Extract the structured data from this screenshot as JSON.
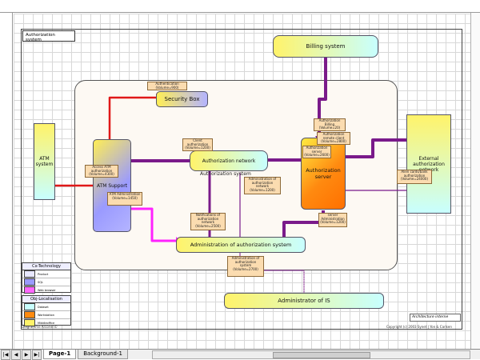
{
  "tabs": [
    "Page-1",
    "Background-1"
  ],
  "diagram": {
    "title": "Authorization system",
    "nodes": {
      "billing": "Billing system",
      "atm_system": "ATM system",
      "security_box": "Security Box",
      "atm_support": "ATM Support",
      "auth_network": "Authorization network",
      "auth_system_sub": "Authorization system",
      "auth_server": "Authorization server",
      "external": "External authorization network",
      "admin_auth": "Administration of authorization system",
      "admin_is": "Administrator of IS"
    },
    "labels": {
      "auth_vol": "Authentication (Volume=900)",
      "access_atm": "Access ATM authorization (Volume=4300)",
      "atm_admin": "ATM Administration (Volume=1450)",
      "client_auth": "Client authorization (Volume=1200)",
      "admin_auth_net": "Administration of authorization network (Volume=1200)",
      "notifications": "Notifications of authorization network (Volume=2500)",
      "auth_billing": "Authorization Billing (Volume=20)",
      "auth_remote": "Authorization remote client (Volume=2800)",
      "auth_server_vol": "Authorization server (Volume=2600)",
      "alien_cards": "Alien cards/bank authorization (Volume=24000)",
      "server_admin": "server Administration (Volume=1200)",
      "admin_sys": "Administration of authorization system (Volume=2700)"
    }
  },
  "legend_technology": {
    "title": "Cx-Technology",
    "items": [
      "Product",
      "SQL",
      "Web browser"
    ]
  },
  "legend_localisation": {
    "title": "Obj-Localisation",
    "items": [
      "Dataset",
      "Workstation",
      "Middleoffice"
    ]
  },
  "architecture_label": "Architecture interne",
  "footer_left": "Diagramme ArcoFen©",
  "footer_right": "Copyright (c) 2003 Synet | Yon & Carlsen"
}
